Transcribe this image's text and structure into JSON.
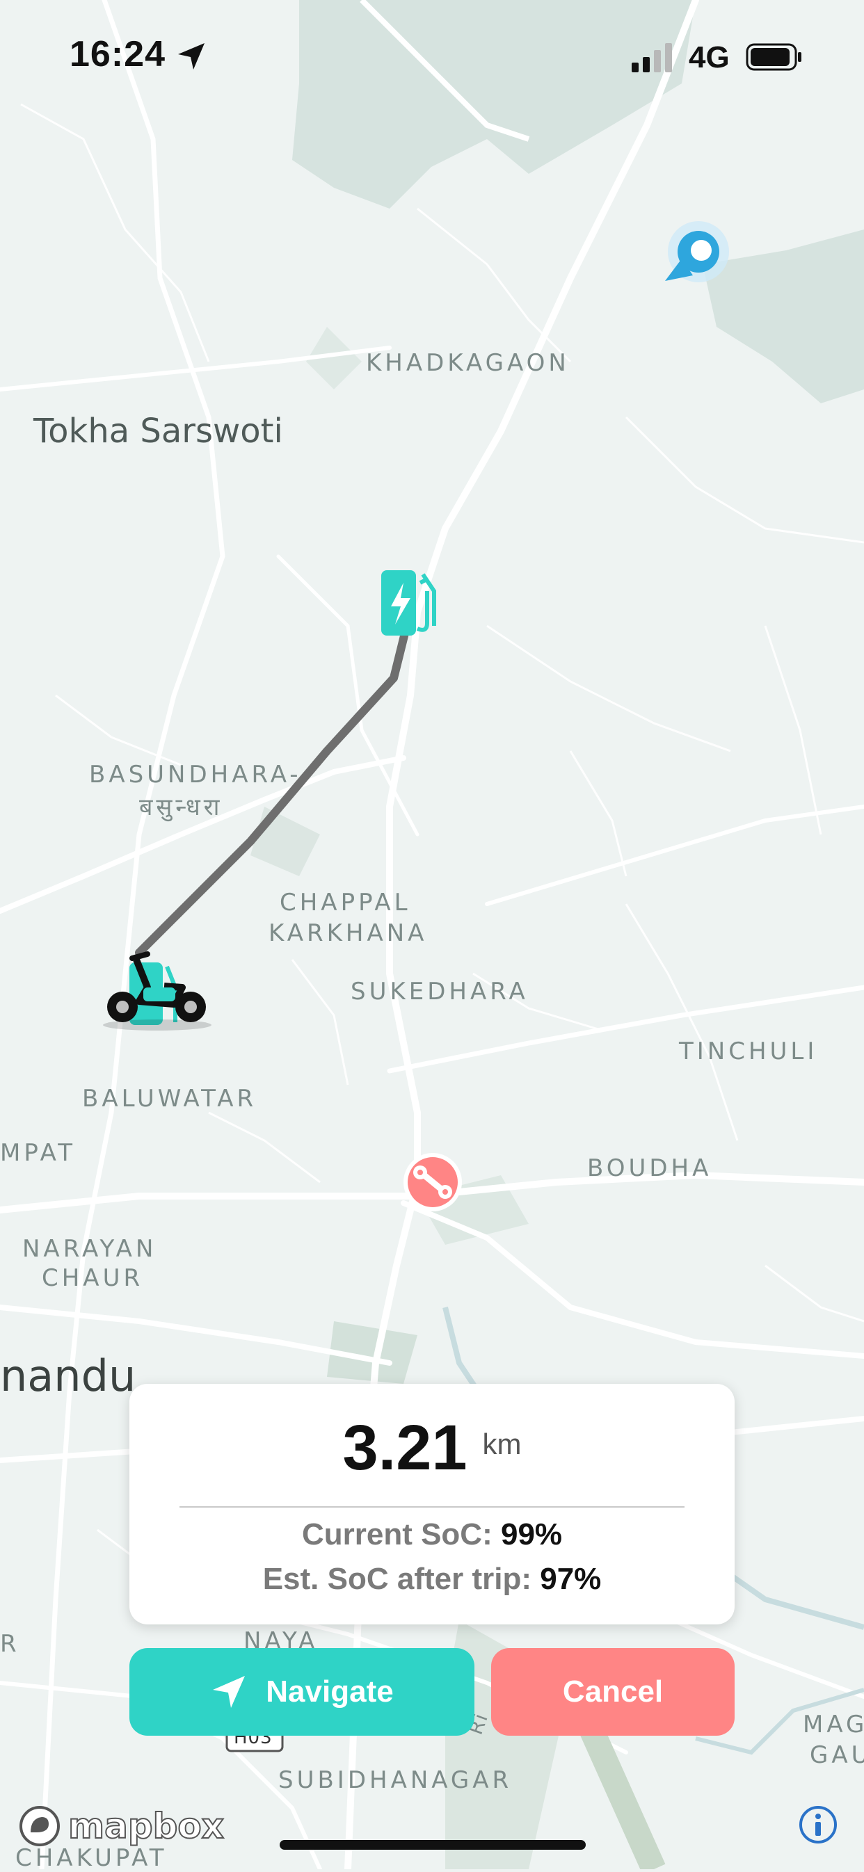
{
  "status_bar": {
    "time": "16:24",
    "network": "4G"
  },
  "map": {
    "labels": {
      "khadkagaon": "KHADKAGAON",
      "tokha": "Tokha Sarswoti",
      "basundhara": "BASUNDHARA-",
      "basundhara_np": "बसुन्धरा",
      "chappal": "CHAPPAL",
      "karkhana": "KARKHANA",
      "sukedhara": "SUKEDHARA",
      "tinchuli": "TINCHULI",
      "baluwatar": "BALUWATAR",
      "mpat": "MPAT",
      "boudha": "BOUDHA",
      "narayan": "NARAYAN",
      "chaur": "CHAUR",
      "kathmandu": "nandu",
      "naya": "NAYA",
      "r": "R",
      "subidhanagar": "SUBIDHANAGAR",
      "mag": "MAG",
      "gau": "GAU",
      "chakupat": "CHAKUPAT",
      "h03": "H03",
      "river": "Ri"
    },
    "icons": [
      "user-location-icon",
      "charging-station-icon",
      "scooter-icon",
      "service-center-icon"
    ],
    "route_color": "#6e6e6e"
  },
  "trip_card": {
    "distance": "3.21",
    "distance_unit": "km",
    "current_soc_label": "Current SoC:",
    "current_soc_value": "99%",
    "est_soc_label": "Est. SoC after trip:",
    "est_soc_value": "97%"
  },
  "actions": {
    "navigate_label": "Navigate",
    "cancel_label": "Cancel"
  },
  "attribution": {
    "logo_text": "mapbox"
  },
  "colors": {
    "accent": "#2fd3c6",
    "cancel": "#ff8585",
    "map_bg": "#eef3f2"
  }
}
